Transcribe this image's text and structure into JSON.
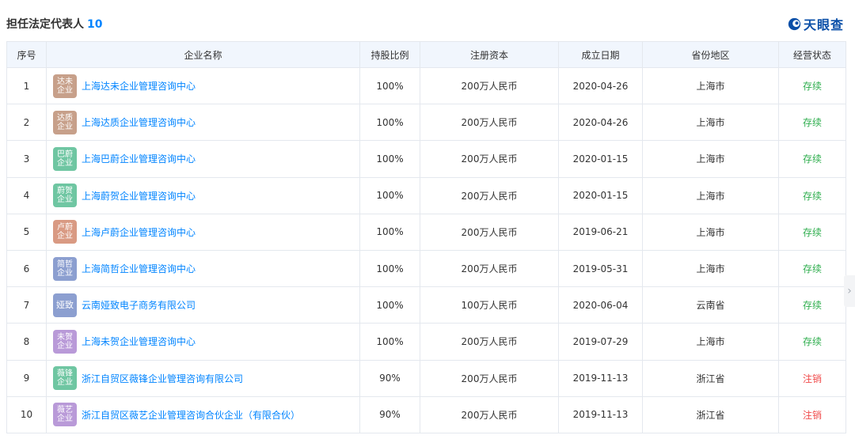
{
  "header": {
    "title": "担任法定代表人",
    "count": "10",
    "brand": "天眼查"
  },
  "columns": {
    "index": "序号",
    "name": "企业名称",
    "share": "持股比例",
    "capital": "注册资本",
    "date": "成立日期",
    "region": "省份地区",
    "status": "经营状态"
  },
  "rows": [
    {
      "index": "1",
      "logo": "达未企业",
      "logo_color": "#c7a08a",
      "name": "上海达未企业管理咨询中心",
      "share": "100%",
      "capital": "200万人民币",
      "date": "2020-04-26",
      "region": "上海市",
      "status": "存续",
      "status_color": "#2fae4e"
    },
    {
      "index": "2",
      "logo": "达质企业",
      "logo_color": "#c7a08a",
      "name": "上海达质企业管理咨询中心",
      "share": "100%",
      "capital": "200万人民币",
      "date": "2020-04-26",
      "region": "上海市",
      "status": "存续",
      "status_color": "#2fae4e"
    },
    {
      "index": "3",
      "logo": "巴蔚企业",
      "logo_color": "#6fc6a2",
      "name": "上海巴蔚企业管理咨询中心",
      "share": "100%",
      "capital": "200万人民币",
      "date": "2020-01-15",
      "region": "上海市",
      "status": "存续",
      "status_color": "#2fae4e"
    },
    {
      "index": "4",
      "logo": "蔚贺企业",
      "logo_color": "#6fc6a2",
      "name": "上海蔚贺企业管理咨询中心",
      "share": "100%",
      "capital": "200万人民币",
      "date": "2020-01-15",
      "region": "上海市",
      "status": "存续",
      "status_color": "#2fae4e"
    },
    {
      "index": "5",
      "logo": "卢蔚企业",
      "logo_color": "#d99a83",
      "name": "上海卢蔚企业管理咨询中心",
      "share": "100%",
      "capital": "200万人民币",
      "date": "2019-06-21",
      "region": "上海市",
      "status": "存续",
      "status_color": "#2fae4e"
    },
    {
      "index": "6",
      "logo": "简哲企业",
      "logo_color": "#8c9fd0",
      "name": "上海简哲企业管理咨询中心",
      "share": "100%",
      "capital": "200万人民币",
      "date": "2019-05-31",
      "region": "上海市",
      "status": "存续",
      "status_color": "#2fae4e"
    },
    {
      "index": "7",
      "logo": "娅致",
      "logo_color": "#8c9fd0",
      "name": "云南娅致电子商务有限公司",
      "share": "100%",
      "capital": "100万人民币",
      "date": "2020-06-04",
      "region": "云南省",
      "status": "存续",
      "status_color": "#2fae4e"
    },
    {
      "index": "8",
      "logo": "未贺企业",
      "logo_color": "#b99ad8",
      "name": "上海未贺企业管理咨询中心",
      "share": "100%",
      "capital": "200万人民币",
      "date": "2019-07-29",
      "region": "上海市",
      "status": "存续",
      "status_color": "#2fae4e"
    },
    {
      "index": "9",
      "logo": "薇锋企业",
      "logo_color": "#6fc6a2",
      "name": "浙江自贸区薇锋企业管理咨询有限公司",
      "share": "90%",
      "capital": "200万人民币",
      "date": "2019-11-13",
      "region": "浙江省",
      "status": "注销",
      "status_color": "#f04b4b"
    },
    {
      "index": "10",
      "logo": "薇艺企业",
      "logo_color": "#b99ad8",
      "name": "浙江自贸区薇艺企业管理咨询合伙企业（有限合伙）",
      "share": "90%",
      "capital": "200万人民币",
      "date": "2019-11-13",
      "region": "浙江省",
      "status": "注销",
      "status_color": "#f04b4b"
    }
  ],
  "side_arrow": "›"
}
